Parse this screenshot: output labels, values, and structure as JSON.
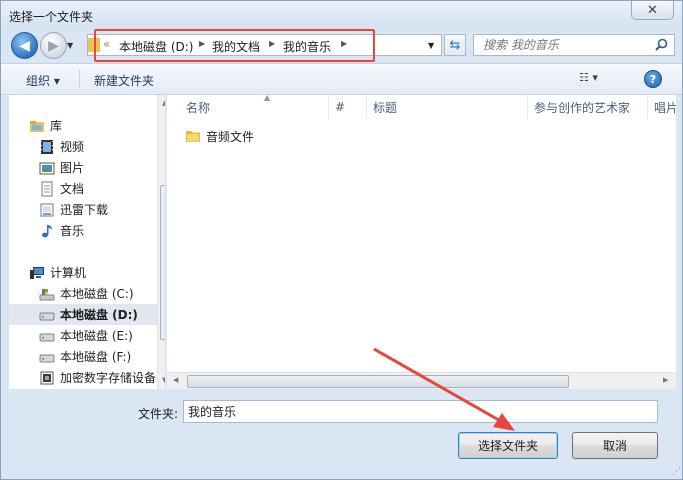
{
  "window": {
    "title": "选择一个文件夹",
    "close_label": "✕"
  },
  "nav": {
    "back_label": "◀",
    "forward_label": "▶",
    "breadcrumb": [
      "本地磁盘 (D:)",
      "我的文档",
      "我的音乐"
    ],
    "overflow": "«",
    "search_placeholder": "搜索 我的音乐"
  },
  "toolbar": {
    "organize": "组织 ▾",
    "new_folder": "新建文件夹",
    "view": "☷ ▾",
    "help": "?"
  },
  "sidebar": {
    "items": [
      {
        "label": "库",
        "icon": "library-icon"
      },
      {
        "label": "视频",
        "icon": "video-icon"
      },
      {
        "label": "图片",
        "icon": "picture-icon"
      },
      {
        "label": "文档",
        "icon": "document-icon"
      },
      {
        "label": "迅雷下载",
        "icon": "download-icon"
      },
      {
        "label": "音乐",
        "icon": "music-icon"
      },
      {
        "label": "计算机",
        "icon": "computer-icon"
      },
      {
        "label": "本地磁盘 (C:)",
        "icon": "system-drive-icon"
      },
      {
        "label": "本地磁盘 (D:)",
        "icon": "drive-icon",
        "selected": true
      },
      {
        "label": "本地磁盘 (E:)",
        "icon": "drive-icon"
      },
      {
        "label": "本地磁盘 (F:)",
        "icon": "drive-icon"
      },
      {
        "label": "加密数字存储设备",
        "icon": "storage-device-icon"
      }
    ]
  },
  "columns": [
    "名称",
    "#",
    "标题",
    "参与创作的艺术家",
    "唱片"
  ],
  "files": [
    {
      "name": "音频文件",
      "icon": "folder-icon"
    }
  ],
  "footer": {
    "folder_label": "文件夹:",
    "folder_value": "我的音乐",
    "select_button": "选择文件夹",
    "cancel_button": "取消"
  },
  "colors": {
    "annotation": "#e8453c",
    "selection": "#e0e7ef",
    "chrome": "#dae6f3"
  }
}
